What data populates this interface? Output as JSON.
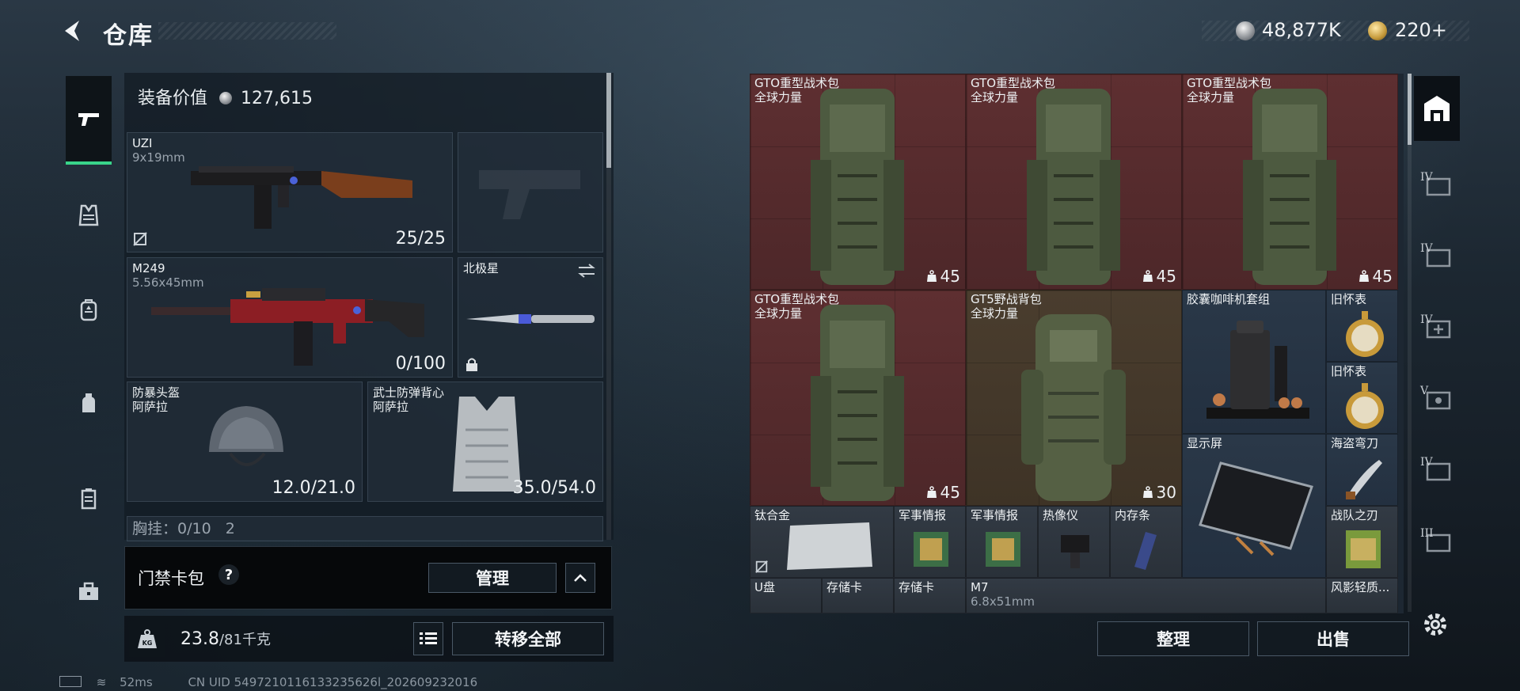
{
  "header": {
    "title": "仓库"
  },
  "currency": {
    "silver": "48,877K",
    "gold": "220+"
  },
  "equipment": {
    "value_label": "装备价值",
    "value": "127,615",
    "slots": {
      "primary": {
        "name": "UZI",
        "caliber": "9x19mm",
        "ammo": "25/25"
      },
      "secondary_empty": {},
      "heavy": {
        "name": "M249",
        "caliber": "5.56x45mm",
        "ammo": "0/100"
      },
      "melee": {
        "name": "北极星"
      },
      "helmet": {
        "name": "防暴头盔",
        "brand": "阿萨拉",
        "durability": "12.0/21.0"
      },
      "armor": {
        "name": "武士防弹背心",
        "brand": "阿萨拉",
        "durability": "35.0/54.0"
      },
      "chest_rig": {
        "label": "胸挂：0/10",
        "extra": "2"
      }
    }
  },
  "card_bag": {
    "label": "门禁卡包",
    "help": "?",
    "manage_label": "管理"
  },
  "bottom": {
    "weight": "23.8",
    "weight_cap": "/81千克",
    "transfer_all": "转移全部"
  },
  "storage": {
    "items": [
      {
        "name": "GTO重型战术包",
        "sub": "全球力量",
        "count": "45"
      },
      {
        "name": "GTO重型战术包",
        "sub": "全球力量",
        "count": "45"
      },
      {
        "name": "GTO重型战术包",
        "sub": "全球力量",
        "count": "45"
      },
      {
        "name": "GTO重型战术包",
        "sub": "全球力量",
        "count": "45"
      },
      {
        "name": "GT5野战背包",
        "sub": "全球力量",
        "count": "30"
      },
      {
        "name": "胶囊咖啡机套组"
      },
      {
        "name": "旧怀表"
      },
      {
        "name": "旧怀表"
      },
      {
        "name": "显示屏"
      },
      {
        "name": "海盗弯刀"
      },
      {
        "name": "钛合金"
      },
      {
        "name": "军事情报"
      },
      {
        "name": "军事情报"
      },
      {
        "name": "热像仪"
      },
      {
        "name": "内存条"
      },
      {
        "name": "战队之刃"
      },
      {
        "name": "U盘"
      },
      {
        "name": "存储卡"
      },
      {
        "name": "存储卡"
      },
      {
        "name": "M7",
        "sub": "6.8x51mm"
      },
      {
        "name": "风影轻质..."
      }
    ],
    "sort_label": "整理",
    "sell_label": "出售"
  },
  "sidebar_tabs": [
    "IV",
    "IV",
    "IV",
    "V",
    "IV",
    "III"
  ],
  "footer": {
    "ping": "52ms",
    "uid": "CN UID 5497210116133235626l_202609232016"
  },
  "colors": {
    "accent": "#39d48a",
    "rare_red": "#5e2f31",
    "rare_brown": "#4a3d2e",
    "rare_blue": "#2a3848"
  }
}
